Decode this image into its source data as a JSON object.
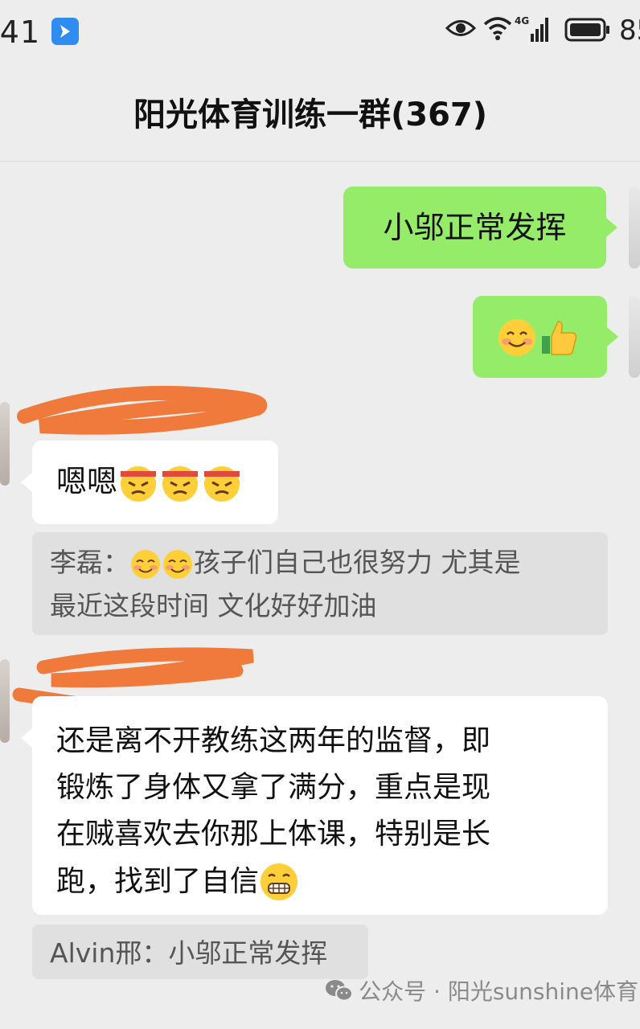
{
  "status_bar": {
    "time": ":41",
    "battery": "85",
    "network": "4G"
  },
  "chat": {
    "title": "阳光体育训练一群(367)"
  },
  "messages": {
    "out1": "小邬正常发挥",
    "in1_text": "嗯嗯",
    "in1_emoji": "facepalm-headband-emoji",
    "quote1": {
      "author": "李磊：",
      "line1_rest": "孩子们自己也很努力 尤其是",
      "line2": "最近这段时间 文化好好加油"
    },
    "in2": {
      "line1": "还是离不开教练这两年的监督，即",
      "line2": "锻炼了身体又拿了满分，重点是现",
      "line3": "在贼喜欢去你那上体课，特别是长",
      "line4": "跑，找到了自信"
    },
    "quote2": "Alvin邢：小邬正常发挥"
  },
  "watermark": "公众号 · 阳光sunshine体育",
  "colors": {
    "background": "#ededed",
    "outgoing_bubble": "#95ec69",
    "incoming_bubble": "#ffffff",
    "quote_bg": "#e0e0e0",
    "redaction": "#f07a3c"
  }
}
